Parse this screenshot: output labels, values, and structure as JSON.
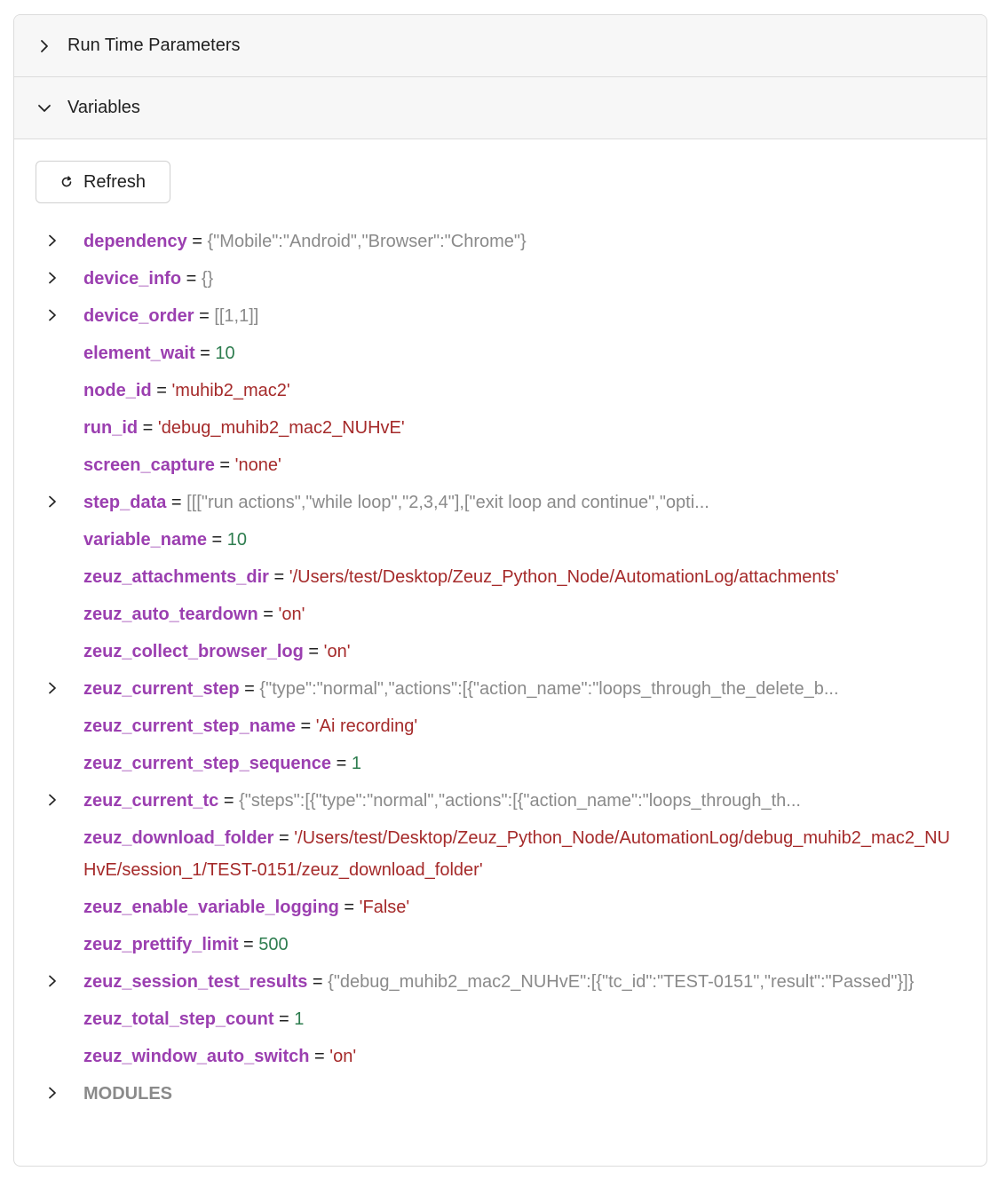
{
  "sections": {
    "run_time_parameters": {
      "title": "Run Time Parameters",
      "expanded": false
    },
    "variables": {
      "title": "Variables",
      "expanded": true
    }
  },
  "refresh_label": "Refresh",
  "variables": [
    {
      "key": "dependency",
      "value": "{\"Mobile\":\"Android\",\"Browser\":\"Chrome\"}",
      "type": "object",
      "expandable": true
    },
    {
      "key": "device_info",
      "value": "{}",
      "type": "object",
      "expandable": true
    },
    {
      "key": "device_order",
      "value": "[[1,1]]",
      "type": "object",
      "expandable": true
    },
    {
      "key": "element_wait",
      "value": "10",
      "type": "number",
      "expandable": false
    },
    {
      "key": "node_id",
      "value": "'muhib2_mac2'",
      "type": "string",
      "expandable": false
    },
    {
      "key": "run_id",
      "value": "'debug_muhib2_mac2_NUHvE'",
      "type": "string",
      "expandable": false
    },
    {
      "key": "screen_capture",
      "value": "'none'",
      "type": "string",
      "expandable": false
    },
    {
      "key": "step_data",
      "value": "[[[\"run actions\",\"while loop\",\"2,3,4\"],[\"exit loop and continue\",\"opti...",
      "type": "object",
      "expandable": true
    },
    {
      "key": "variable_name",
      "value": "10",
      "type": "number",
      "expandable": false
    },
    {
      "key": "zeuz_attachments_dir",
      "value": "'/Users/test/Desktop/Zeuz_Python_Node/AutomationLog/attachments'",
      "type": "string",
      "expandable": false
    },
    {
      "key": "zeuz_auto_teardown",
      "value": "'on'",
      "type": "string",
      "expandable": false
    },
    {
      "key": "zeuz_collect_browser_log",
      "value": "'on'",
      "type": "string",
      "expandable": false
    },
    {
      "key": "zeuz_current_step",
      "value": "{\"type\":\"normal\",\"actions\":[{\"action_name\":\"loops_through_the_delete_b...",
      "type": "object",
      "expandable": true
    },
    {
      "key": "zeuz_current_step_name",
      "value": "'Ai recording'",
      "type": "string",
      "expandable": false
    },
    {
      "key": "zeuz_current_step_sequence",
      "value": "1",
      "type": "number",
      "expandable": false
    },
    {
      "key": "zeuz_current_tc",
      "value": "{\"steps\":[{\"type\":\"normal\",\"actions\":[{\"action_name\":\"loops_through_th...",
      "type": "object",
      "expandable": true
    },
    {
      "key": "zeuz_download_folder",
      "value": "'/Users/test/Desktop/Zeuz_Python_Node/AutomationLog/debug_muhib2_mac2_NUHvE/session_1/TEST-0151/zeuz_download_folder'",
      "type": "string",
      "expandable": false
    },
    {
      "key": "zeuz_enable_variable_logging",
      "value": "'False'",
      "type": "string",
      "expandable": false
    },
    {
      "key": "zeuz_prettify_limit",
      "value": "500",
      "type": "number",
      "expandable": false
    },
    {
      "key": "zeuz_session_test_results",
      "value": "{\"debug_muhib2_mac2_NUHvE\":[{\"tc_id\":\"TEST-0151\",\"result\":\"Passed\"}]}",
      "type": "object",
      "expandable": true
    },
    {
      "key": "zeuz_total_step_count",
      "value": "1",
      "type": "number",
      "expandable": false
    },
    {
      "key": "zeuz_window_auto_switch",
      "value": "'on'",
      "type": "string",
      "expandable": false
    }
  ],
  "modules_label": "MODULES",
  "equals_sign": " = ",
  "colors": {
    "key": "#9b3fb0",
    "string": "#a52a2a",
    "number": "#2e7d4f",
    "object": "#8a8a8a"
  },
  "icons": {
    "collapsed": "chevron-right-icon",
    "expanded": "chevron-down-icon",
    "refresh": "refresh-icon"
  }
}
